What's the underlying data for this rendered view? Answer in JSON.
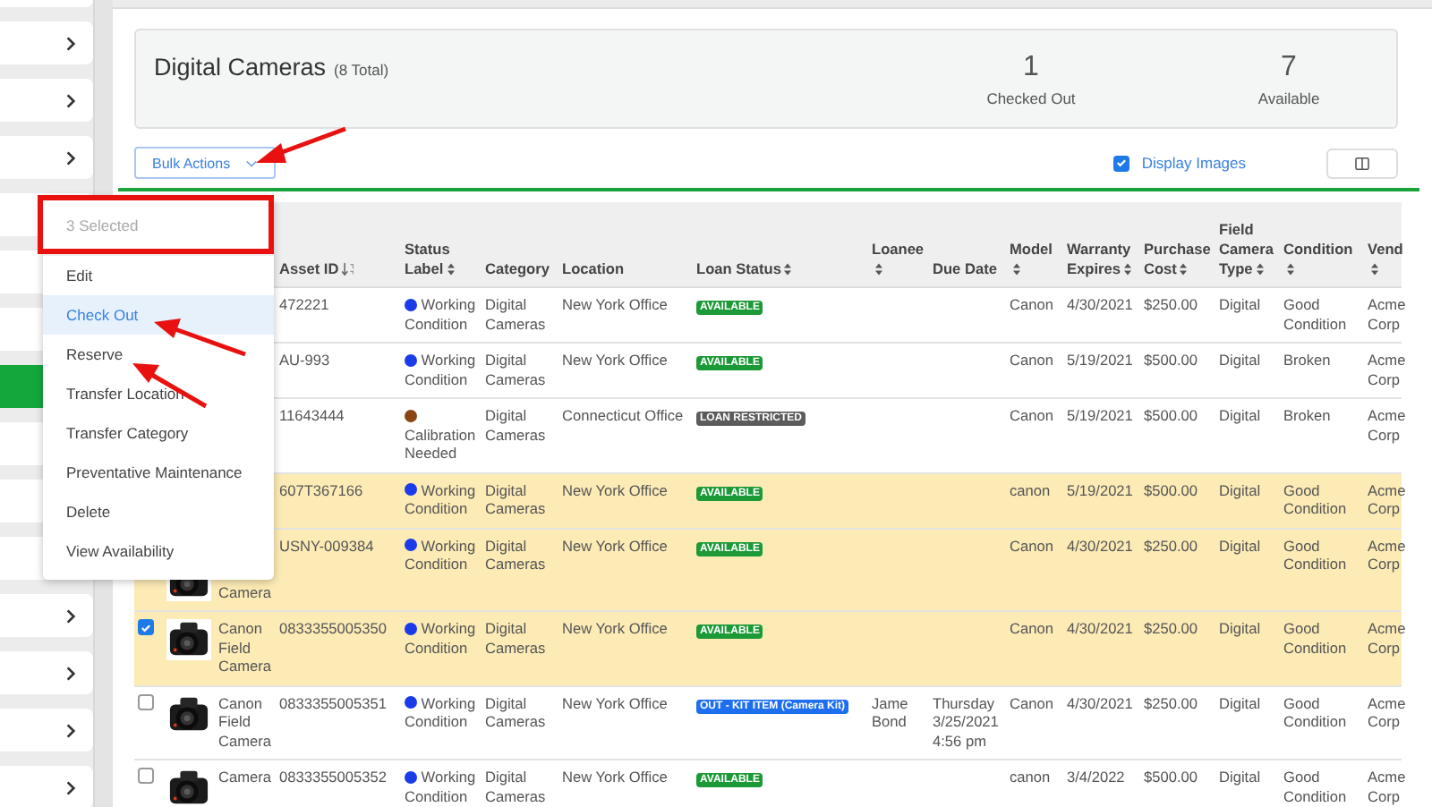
{
  "sidebar": {
    "items": [
      {
        "selected": false
      },
      {
        "selected": false
      },
      {
        "selected": false
      },
      {
        "selected": false
      },
      {
        "selected": false
      },
      {
        "selected": false
      },
      {
        "selected": false
      },
      {
        "selected": true
      },
      {
        "selected": false
      },
      {
        "selected": false
      },
      {
        "selected": false
      },
      {
        "selected": false
      },
      {
        "selected": false
      },
      {
        "selected": false
      },
      {
        "selected": false
      }
    ]
  },
  "summary": {
    "title": "Digital Cameras",
    "total": "(8 Total)",
    "stats": [
      {
        "value": "1",
        "label": "Checked Out"
      },
      {
        "value": "7",
        "label": "Available"
      }
    ]
  },
  "toolbar": {
    "bulk_actions": "Bulk Actions",
    "display_images": {
      "label": "Display Images",
      "checked": true
    }
  },
  "bulk_menu": {
    "header": "3 Selected",
    "items": [
      {
        "label": "Edit",
        "selected": false
      },
      {
        "label": "Check Out",
        "selected": true
      },
      {
        "label": "Reserve",
        "selected": false
      },
      {
        "label": "Transfer Location",
        "selected": false
      },
      {
        "label": "Transfer Category",
        "selected": false
      },
      {
        "label": "Preventative Maintenance",
        "selected": false
      },
      {
        "label": "Delete",
        "selected": false
      },
      {
        "label": "View Availability",
        "selected": false
      }
    ]
  },
  "table": {
    "columns": [
      {
        "label": "Asset ID",
        "sortable": true,
        "sorted": true
      },
      {
        "label": "Status Label",
        "sortable": true,
        "sorted": false
      },
      {
        "label": "Category",
        "sortable": false,
        "sorted": false
      },
      {
        "label": "Location",
        "sortable": false,
        "sorted": false
      },
      {
        "label": "Loan Status",
        "sortable": true,
        "sorted": false
      },
      {
        "label": "Loanee",
        "sortable": true,
        "sorted": false
      },
      {
        "label": "Due Date",
        "sortable": false,
        "sorted": false
      },
      {
        "label": "Model",
        "sortable": true,
        "sorted": false
      },
      {
        "label": "Warranty Expires",
        "sortable": true,
        "sorted": false
      },
      {
        "label": "Purchase Cost",
        "sortable": true,
        "sorted": false
      },
      {
        "label": "Field Camera Type",
        "sortable": true,
        "sorted": false
      },
      {
        "label": "Condition",
        "sortable": true,
        "sorted": false
      },
      {
        "label": "Vend",
        "sortable": true,
        "sorted": false
      }
    ],
    "rows": [
      {
        "selected": false,
        "asset_id": "472221",
        "status": {
          "label": "Working Condition",
          "color": "#1a3be8"
        },
        "category": "Digital Cameras",
        "location": "New York Office",
        "loan_status": {
          "label": "AVAILABLE",
          "kind": "available"
        },
        "model": "Canon",
        "warranty": "4/30/2021",
        "cost": "$250.00",
        "type": "Digital",
        "condition": "Good Condition",
        "vendor": "Acme Corp"
      },
      {
        "selected": false,
        "asset_id": "AU-993",
        "status": {
          "label": "Working Condition",
          "color": "#1a3be8"
        },
        "category": "Digital Cameras",
        "location": "New York Office",
        "loan_status": {
          "label": "AVAILABLE",
          "kind": "available"
        },
        "model": "Canon",
        "warranty": "5/19/2021",
        "cost": "$500.00",
        "type": "Digital",
        "condition": "Broken",
        "vendor": "Acme Corp"
      },
      {
        "selected": false,
        "asset_id": "11643444",
        "status": {
          "label": "Calibration Needed",
          "color": "#8b4513"
        },
        "category": "Digital Cameras",
        "location": "Connecticut Office",
        "loan_status": {
          "label": "LOAN RESTRICTED",
          "kind": "restricted"
        },
        "model": "Canon",
        "warranty": "5/19/2021",
        "cost": "$500.00",
        "type": "Digital",
        "condition": "Broken",
        "vendor": "Acme Corp"
      },
      {
        "selected": true,
        "asset_id": "607T367166",
        "status": {
          "label": "Working Condition",
          "color": "#1a3be8"
        },
        "category": "Digital Cameras",
        "location": "New York Office",
        "loan_status": {
          "label": "AVAILABLE",
          "kind": "available"
        },
        "model": "canon",
        "warranty": "5/19/2021",
        "cost": "$500.00",
        "type": "Digital",
        "condition": "Good Condition",
        "vendor": "Acme Corp"
      },
      {
        "selected": true,
        "name": "Camera",
        "name_partial": true,
        "asset_id": "USNY-009384",
        "status": {
          "label": "Working Condition",
          "color": "#1a3be8"
        },
        "category": "Digital Cameras",
        "location": "New York Office",
        "loan_status": {
          "label": "AVAILABLE",
          "kind": "available"
        },
        "model": "Canon",
        "warranty": "4/30/2021",
        "cost": "$250.00",
        "type": "Digital",
        "condition": "Good Condition",
        "vendor": "Acme Corp"
      },
      {
        "selected": true,
        "name": "Canon Field Camera",
        "asset_id": "0833355005350",
        "status": {
          "label": "Working Condition",
          "color": "#1a3be8"
        },
        "category": "Digital Cameras",
        "location": "New York Office",
        "loan_status": {
          "label": "AVAILABLE",
          "kind": "available"
        },
        "model": "Canon",
        "warranty": "4/30/2021",
        "cost": "$250.00",
        "type": "Digital",
        "condition": "Good Condition",
        "vendor": "Acme Corp"
      },
      {
        "selected": false,
        "name": "Canon Field Camera",
        "asset_id": "0833355005351",
        "status": {
          "label": "Working Condition",
          "color": "#1a3be8"
        },
        "category": "Digital Cameras",
        "location": "New York Office",
        "loan_status": {
          "label": "OUT - KIT ITEM (Camera Kit)",
          "kind": "out"
        },
        "loanee": "Jame Bond",
        "due_date": "Thursday 3/25/2021 4:56 pm",
        "model": "Canon",
        "warranty": "4/30/2021",
        "cost": "$250.00",
        "type": "Digital",
        "condition": "Good Condition",
        "vendor": "Acme Corp"
      },
      {
        "selected": false,
        "name": "Camera",
        "asset_id": "0833355005352",
        "status": {
          "label": "Working Condition",
          "color": "#1a3be8"
        },
        "category": "Digital Cameras",
        "location": "New York Office",
        "loan_status": {
          "label": "AVAILABLE",
          "kind": "available"
        },
        "model": "canon",
        "warranty": "3/4/2022",
        "cost": "$500.00",
        "type": "Digital",
        "condition": "Good Condition",
        "vendor": "Acme Corp"
      }
    ]
  }
}
